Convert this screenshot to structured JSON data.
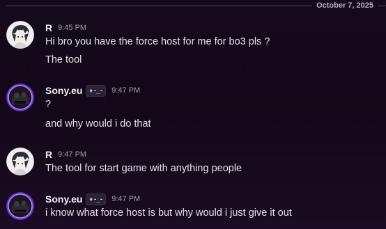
{
  "date_divider": "October 7, 2025",
  "messages": [
    {
      "author": "R",
      "time": "9:45 PM",
      "lines": [
        "Hi bro you have the force host for me for bo3 pls ?",
        "The tool"
      ]
    },
    {
      "author": "Sony.eu",
      "tag": "-_-",
      "tag_icon": "diamond-icon",
      "time": "9:47 PM",
      "lines": [
        "?",
        "and why would i do that"
      ]
    },
    {
      "author": "R",
      "time": "9:47 PM",
      "lines": [
        "The tool for start game with anything people"
      ]
    },
    {
      "author": "Sony.eu",
      "tag": "-_-",
      "tag_icon": "diamond-icon",
      "time": "9:47 PM",
      "lines": [
        "i know what force host is but why would i just give it out"
      ]
    }
  ],
  "colors": {
    "background": "#140a1d",
    "username": "#f2eef5",
    "timestamp": "#a39cab",
    "divider": "#4a3b55",
    "avatar_ring": "#7a3cff"
  }
}
